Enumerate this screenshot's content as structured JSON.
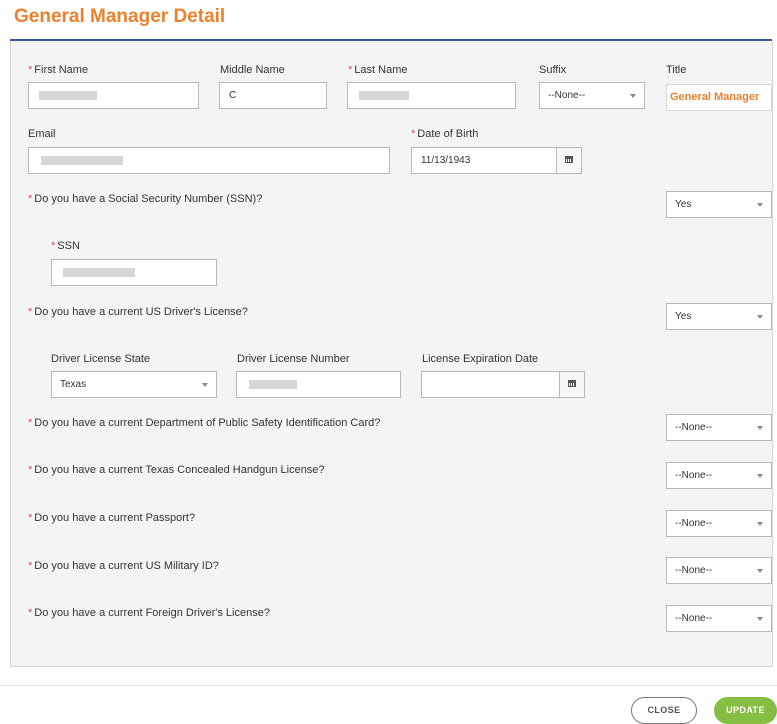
{
  "dialog": {
    "title": "General Manager Detail"
  },
  "fields": {
    "first_name": {
      "label": "First Name",
      "value": ""
    },
    "middle_name": {
      "label": "Middle Name",
      "value": "C"
    },
    "last_name": {
      "label": "Last Name",
      "value": ""
    },
    "suffix": {
      "label": "Suffix",
      "value": "--None--"
    },
    "title": {
      "label": "Title",
      "value": "General Manager"
    },
    "email": {
      "label": "Email",
      "value": ""
    },
    "dob": {
      "label": "Date of Birth",
      "value": "11/13/1943"
    },
    "ssn_question": {
      "label": "Do you have a Social Security Number (SSN)?",
      "value": "Yes"
    },
    "ssn": {
      "label": "SSN",
      "value": ""
    },
    "us_dl_question": {
      "label": "Do you have a current US Driver's License?",
      "value": "Yes"
    },
    "dl_state": {
      "label": "Driver License State",
      "value": "Texas"
    },
    "dl_number": {
      "label": "Driver License Number",
      "value": ""
    },
    "dl_exp": {
      "label": "License Expiration Date",
      "value": ""
    },
    "dps_question": {
      "label": "Do you have a current Department of Public Safety Identification Card?",
      "value": "--None--"
    },
    "handgun_question": {
      "label": "Do you have a current Texas Concealed Handgun License?",
      "value": "--None--"
    },
    "passport_question": {
      "label": "Do you have a current Passport?",
      "value": "--None--"
    },
    "military_question": {
      "label": "Do you have a current US Military ID?",
      "value": "--None--"
    },
    "foreign_dl_question": {
      "label": "Do you have a current Foreign Driver's License?",
      "value": "--None--"
    }
  },
  "required_marker": "*",
  "footer": {
    "close_label": "CLOSE",
    "update_label": "UPDATE"
  },
  "colors": {
    "accent": "#f07f2c",
    "required": "#d9534f",
    "update": "#86be43",
    "header_rule": "#3b5998"
  }
}
